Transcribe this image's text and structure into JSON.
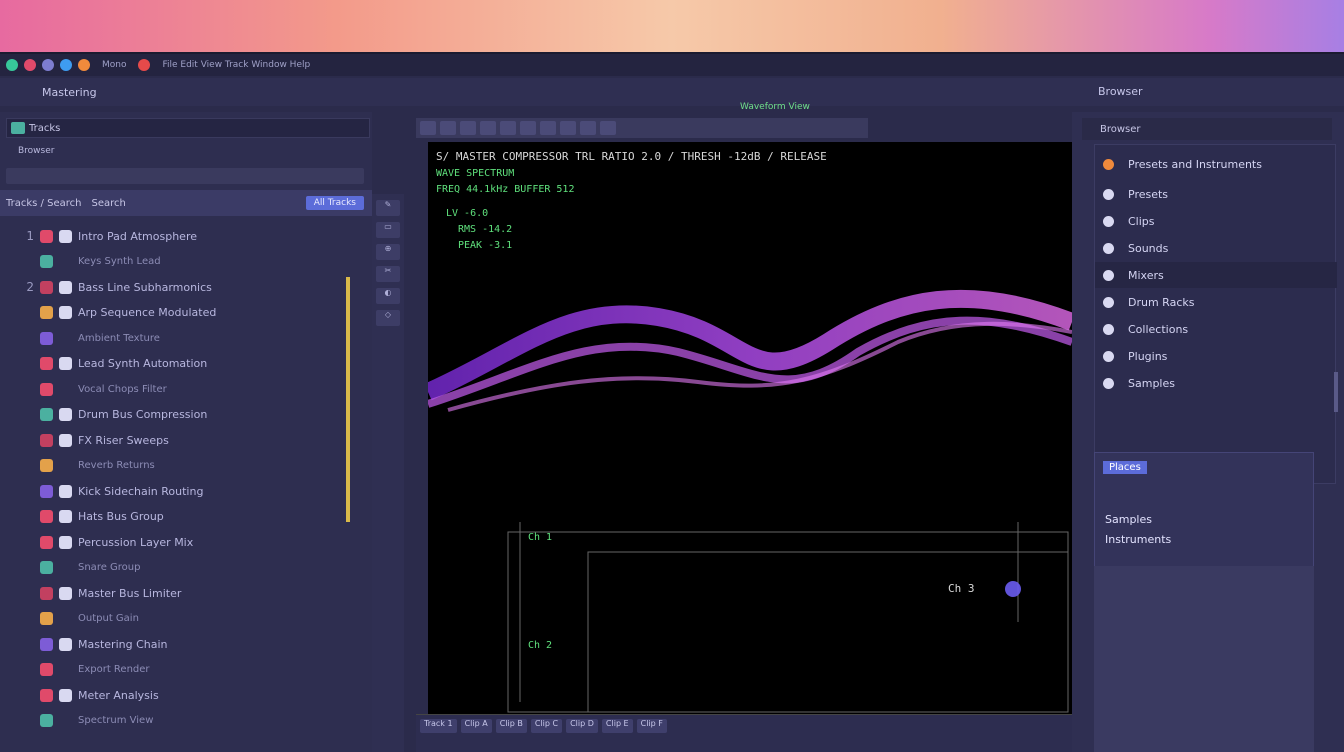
{
  "topbar": {
    "menu_label": "Mono",
    "center_label": "File Edit View Track Window Help"
  },
  "project": {
    "title": "Mastering",
    "right_title": "Browser"
  },
  "left_panel": {
    "header": "Tracks",
    "subheader": "Browser",
    "filter_left": "Tracks / Search",
    "filter_label": "Search",
    "filter_select": "All Tracks",
    "tracks": [
      {
        "num": "1",
        "label": "Intro Pad Atmosphere"
      },
      {
        "num": "",
        "label": "Keys Synth Lead",
        "sub": true
      },
      {
        "num": "2",
        "label": "Bass Line Subharmonics"
      },
      {
        "num": "",
        "label": "Arp Sequence Modulated"
      },
      {
        "num": "",
        "label": "Ambient Texture",
        "sub": true
      },
      {
        "num": "",
        "label": "Lead Synth Automation"
      },
      {
        "num": "",
        "label": "Vocal Chops Filter",
        "sub": true
      },
      {
        "num": "",
        "label": "Drum Bus Compression"
      },
      {
        "num": "",
        "label": "FX Riser Sweeps"
      },
      {
        "num": "",
        "label": "Reverb Returns",
        "sub": true
      },
      {
        "num": "",
        "label": "Kick Sidechain Routing"
      },
      {
        "num": "",
        "label": "Hats Bus Group"
      },
      {
        "num": "",
        "label": "Percussion Layer Mix"
      },
      {
        "num": "",
        "label": "Snare Group",
        "sub": true
      },
      {
        "num": "",
        "label": "Master Bus Limiter"
      },
      {
        "num": "",
        "label": "Output Gain",
        "sub": true
      },
      {
        "num": "",
        "label": "Mastering Chain"
      },
      {
        "num": "",
        "label": "Export Render",
        "sub": true
      },
      {
        "num": "",
        "label": "Meter Analysis"
      },
      {
        "num": "",
        "label": "Spectrum View",
        "sub": true
      }
    ]
  },
  "center": {
    "title": "Waveform View",
    "lines": [
      "S/ MASTER COMPRESSOR TRL RATIO 2.0 / THRESH -12dB / RELEASE",
      "WAVE SPECTRUM",
      "FREQ 44.1kHz BUFFER 512",
      "LV -6.0",
      "RMS -14.2",
      "PEAK -3.1"
    ],
    "bottom_labels": [
      "Ch 1",
      "Ch 2",
      "Ch 3"
    ],
    "timeline": [
      "Track 1",
      "Clip A",
      "Clip B",
      "Clip C",
      "Clip D",
      "Clip E",
      "Clip F"
    ]
  },
  "right_panel": {
    "header": "Browser",
    "top_item": "Presets and Instruments",
    "items": [
      {
        "label": "Presets"
      },
      {
        "label": "Clips"
      },
      {
        "label": "Sounds"
      },
      {
        "label": "Mixers",
        "selected": true
      },
      {
        "label": "Drum Racks"
      },
      {
        "label": "Collections"
      },
      {
        "label": "Plugins"
      },
      {
        "label": "Samples"
      }
    ],
    "panel_title": "Places",
    "panel_text1": "Samples",
    "panel_text2": "Instruments"
  },
  "colors": {
    "accent": "#5c6cd9",
    "wave_purple": "#a64de0",
    "wave_pink": "#e26ae0",
    "green": "#5fe07c"
  }
}
